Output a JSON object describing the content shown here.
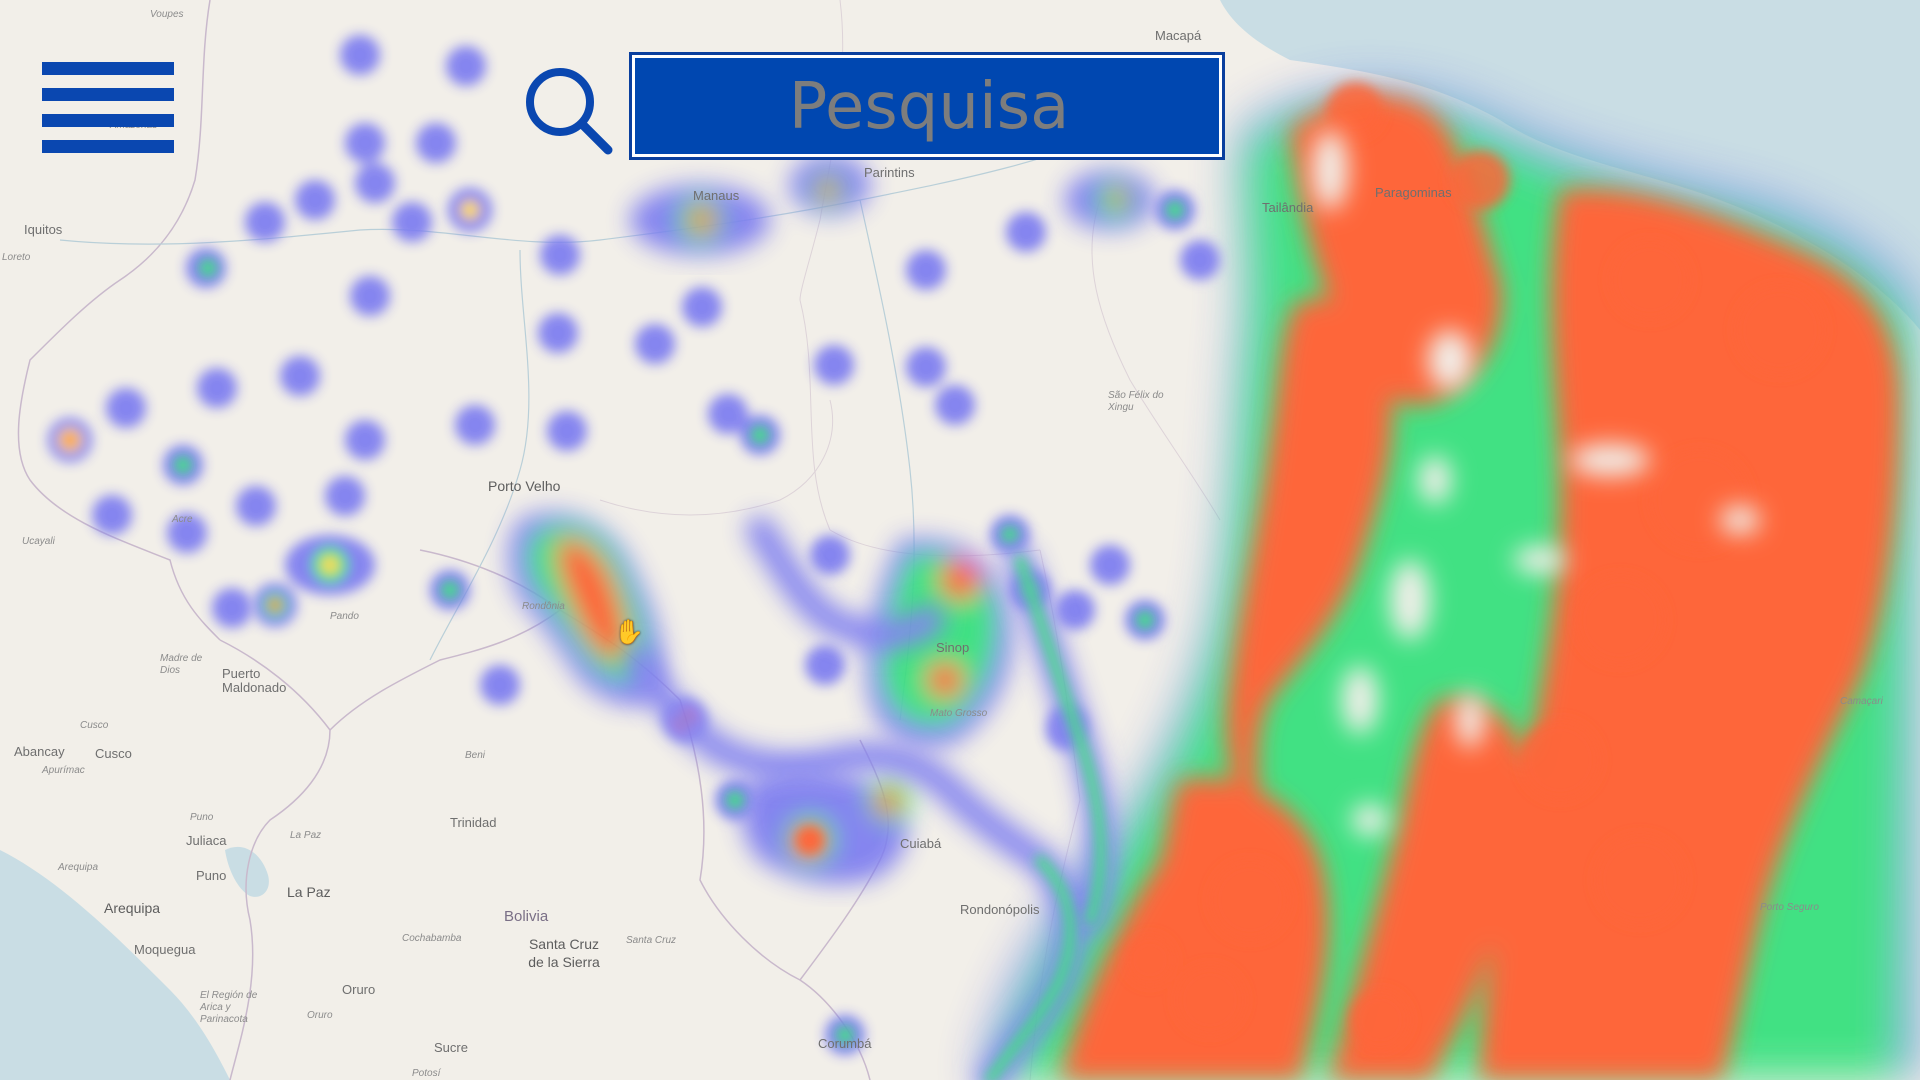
{
  "app": {
    "search_placeholder": "Pesquisa"
  },
  "icons": {
    "menu": "hamburger-menu-icon",
    "search": "search-icon",
    "cursor": "hand-grab-cursor-icon"
  },
  "colors": {
    "accent": "#0047b0",
    "heat_low": "#7b7bf0",
    "heat_mid": "#33e07a",
    "heat_high": "#ff5a2a",
    "ocean": "#c9dde4",
    "land": "#f2efe9"
  },
  "map": {
    "places": {
      "voupes": "Voupes",
      "amazonas": "Amazonas",
      "iquitos": "Iquitos",
      "loreto": "Loreto",
      "macapa": "Macapá",
      "manaus": "Manaus",
      "parintins": "Parintins",
      "tailandia": "Tailândia",
      "paragominas": "Paragominas",
      "porto_velho": "Porto Velho",
      "sao_felix": "São Félix do Xingu",
      "rondonia": "Rondônia",
      "ucayali": "Ucayali",
      "acre": "Acre",
      "pando": "Pando",
      "madre_de_dios": "Madre de Dios",
      "puerto_maldonado": "Puerto Maldonado",
      "cusco_region": "Cusco",
      "cusco": "Cusco",
      "abancay": "Abancay",
      "apurimac": "Apurímac",
      "puno_region": "Puno",
      "juliaca": "Juliaca",
      "puno": "Puno",
      "la_paz_region": "La Paz",
      "la_paz": "La Paz",
      "arequipa_region": "Arequipa",
      "arequipa": "Arequipa",
      "moquegua": "Moquegua",
      "tacna_region": "El Región de Arica y Parinacota",
      "oruro_region": "Oruro",
      "oruro": "Oruro",
      "trinidad": "Trinidad",
      "beni": "Beni",
      "bolivia": "Bolivia",
      "cochabamba": "Cochabamba",
      "santa_cruz": "Santa Cruz de la Sierra",
      "santa_cruz_region": "Santa Cruz",
      "sucre": "Sucre",
      "potosi": "Potosí",
      "corumba": "Corumbá",
      "sinop": "Sinop",
      "mato_grosso": "Mato Grosso",
      "cuiaba": "Cuiabá",
      "rondonopolis": "Rondonópolis",
      "camacari": "Camaçari",
      "porto_seguro": "Porto Seguro"
    }
  }
}
